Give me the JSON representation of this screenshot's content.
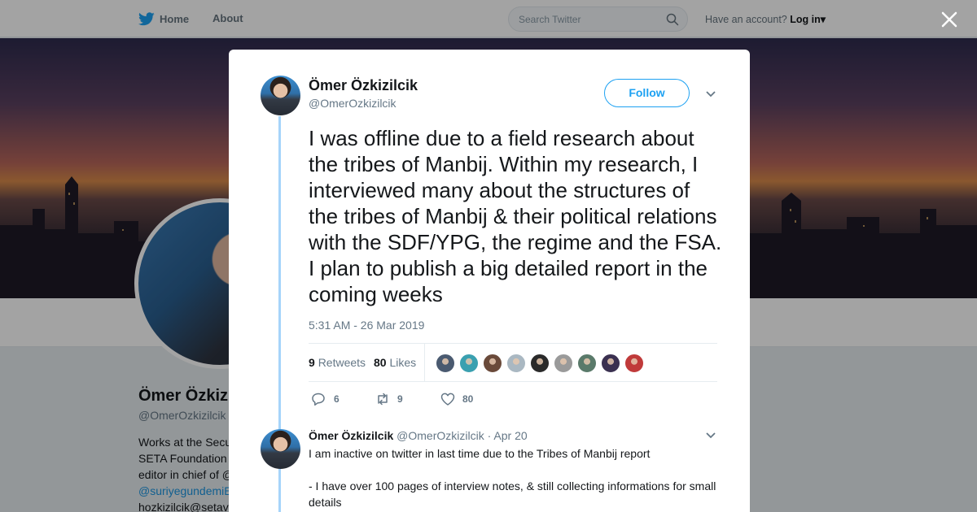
{
  "topbar": {
    "home_label": "Home",
    "about_label": "About",
    "search_placeholder": "Search Twitter",
    "account_prompt": "Have an account?",
    "login_label": "Log in"
  },
  "profile": {
    "name": "Ömer Özkizilcik",
    "handle": "@OmerOzkizilcik",
    "bio_lines": [
      "Works at the Secu",
      "SETA Foundation",
      "editor in chief of @",
      "@suriyegundemiE",
      "hozkizilcik@setav"
    ]
  },
  "tweet": {
    "author_name": "Ömer Özkizilcik",
    "author_handle": "@OmerOzkizilcik",
    "follow_label": "Follow",
    "text": "I was offline due to a field research about the tribes of Manbij. Within my research, I interviewed many about the structures of the tribes of Manbij & their political relations with the SDF/YPG, the regime and the FSA. I plan to publish a big detailed report in the coming weeks",
    "timestamp": "5:31 AM - 26 Mar 2019",
    "retweets_count": "9",
    "retweets_label": "Retweets",
    "likes_count": "80",
    "likes_label": "Likes",
    "likers_colors": [
      "#4a5a70",
      "#3aa0b0",
      "#6a4a3a",
      "#aab8c2",
      "#2a2a2a",
      "#9a9a9a",
      "#5a7a6a",
      "#3a3050",
      "#c03a3a"
    ],
    "actions": {
      "reply_count": "6",
      "retweet_count": "9",
      "like_count": "80"
    }
  },
  "reply": {
    "author_name": "Ömer Özkizilcik",
    "author_handle": "@OmerOzkizilcik",
    "separator": "·",
    "date": "Apr 20",
    "line1": "I am inactive on twitter in last time due to the Tribes of Manbij report",
    "line2": "- I have over 100 pages of interview notes, & still collecting informations for small details"
  },
  "colors": {
    "accent": "#1da1f2",
    "thread": "#a6d4fa",
    "muted": "#657786"
  }
}
